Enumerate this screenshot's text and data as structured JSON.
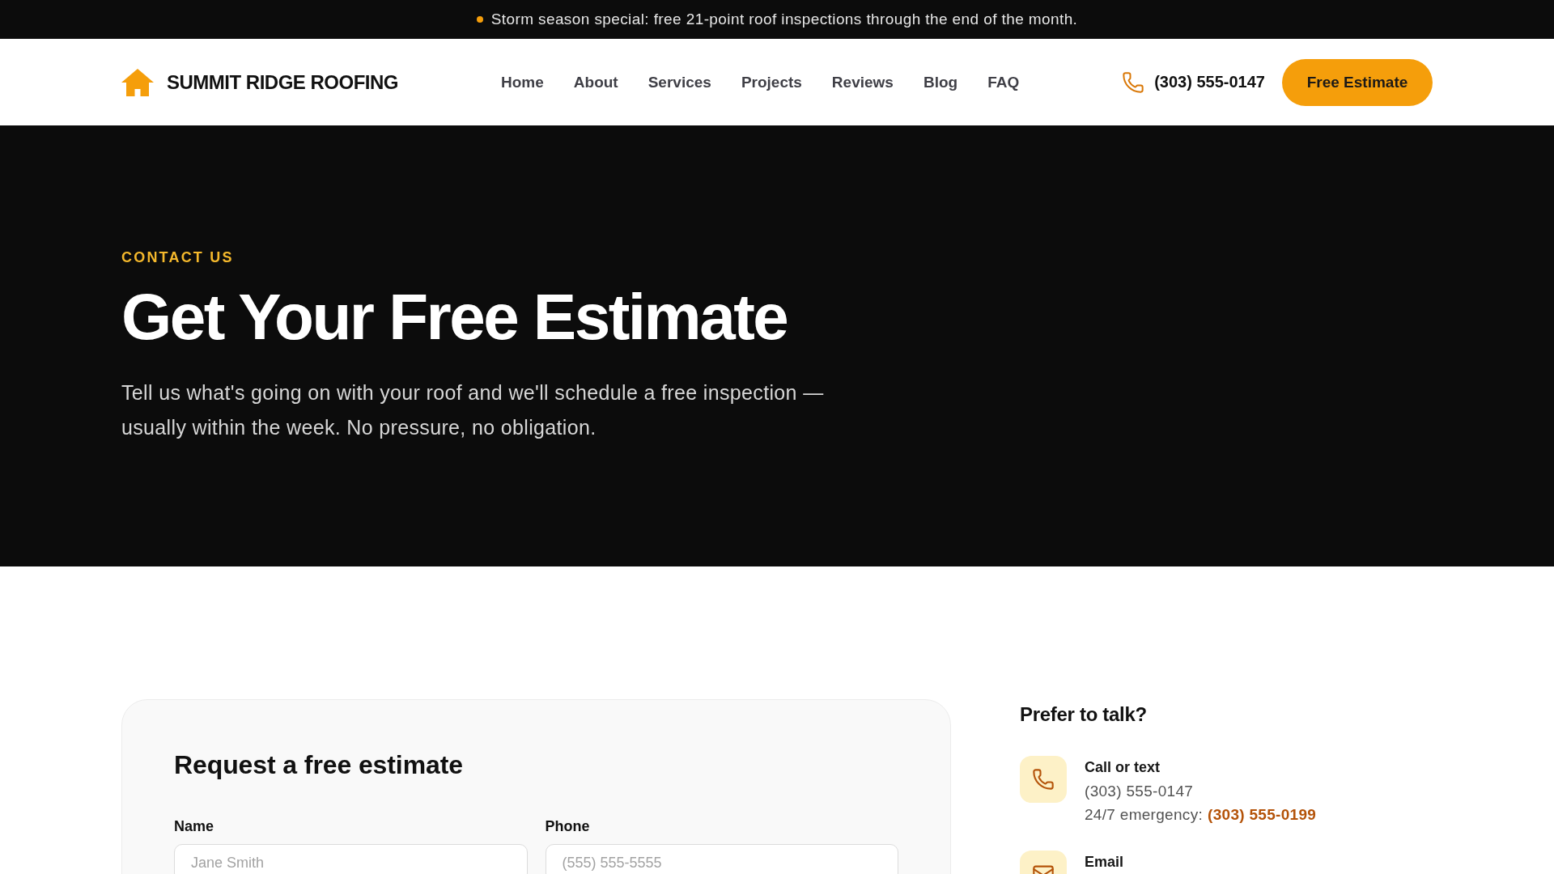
{
  "announcement": {
    "text": "Storm season special: free 21-point roof inspections through the end of the month."
  },
  "header": {
    "brand": "SUMMIT RIDGE ROOFING",
    "nav": [
      {
        "label": "Home"
      },
      {
        "label": "About"
      },
      {
        "label": "Services"
      },
      {
        "label": "Projects"
      },
      {
        "label": "Reviews"
      },
      {
        "label": "Blog"
      },
      {
        "label": "FAQ"
      }
    ],
    "phone": "(303) 555-0147",
    "cta": "Free Estimate"
  },
  "hero": {
    "eyebrow": "CONTACT US",
    "title": "Get Your Free Estimate",
    "text": "Tell us what's going on with your roof and we'll schedule a free inspection — usually within the week. No pressure, no obligation."
  },
  "form": {
    "title": "Request a free estimate",
    "fields": [
      {
        "label": "Name",
        "placeholder": "Jane Smith"
      },
      {
        "label": "Phone",
        "placeholder": "(555) 555-5555"
      }
    ]
  },
  "contact": {
    "title": "Prefer to talk?",
    "methods": [
      {
        "kind": "phone",
        "label": "Call or text",
        "lines": [
          {
            "text": "(303) 555-0147"
          },
          {
            "text": "24/7 emergency:",
            "link": "(303) 555-0199"
          }
        ]
      },
      {
        "kind": "email",
        "label": "Email"
      }
    ]
  }
}
